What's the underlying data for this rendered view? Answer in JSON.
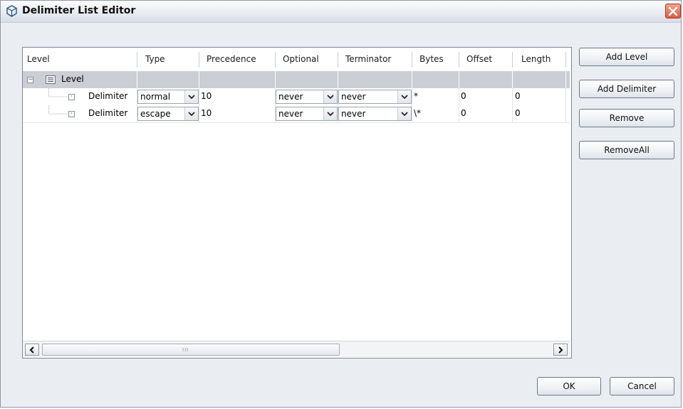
{
  "window": {
    "title": "Delimiter List Editor"
  },
  "table": {
    "columns": [
      "Level",
      "Type",
      "Precedence",
      "Optional",
      "Terminator",
      "Bytes",
      "Offset",
      "Length"
    ],
    "level_row": {
      "label": "Level"
    },
    "rows": [
      {
        "label": "Delimiter",
        "type": "normal",
        "precedence": "10",
        "optional": "never",
        "terminator": "never",
        "bytes": "*",
        "offset": "0",
        "length": "0"
      },
      {
        "label": "Delimiter",
        "type": "escape",
        "precedence": "10",
        "optional": "never",
        "terminator": "never",
        "bytes": "\\*",
        "offset": "0",
        "length": "0"
      }
    ],
    "scroll_grip": "III"
  },
  "side_buttons": {
    "add_level": "Add Level",
    "add_delimiter": "Add Delimiter",
    "remove": "Remove",
    "remove_all": "RemoveAll"
  },
  "footer": {
    "ok": "OK",
    "cancel": "Cancel"
  },
  "colors": {
    "title_gradient_top": "#fbfcfd",
    "close_red": "#dd5b3f",
    "level_row_bg": "#cbced4"
  },
  "icons": {
    "title": "window-app-icon",
    "close": "close-icon",
    "expand": "collapse-minus-icon",
    "list": "list-icon",
    "combo": "chevron-down-icon"
  }
}
